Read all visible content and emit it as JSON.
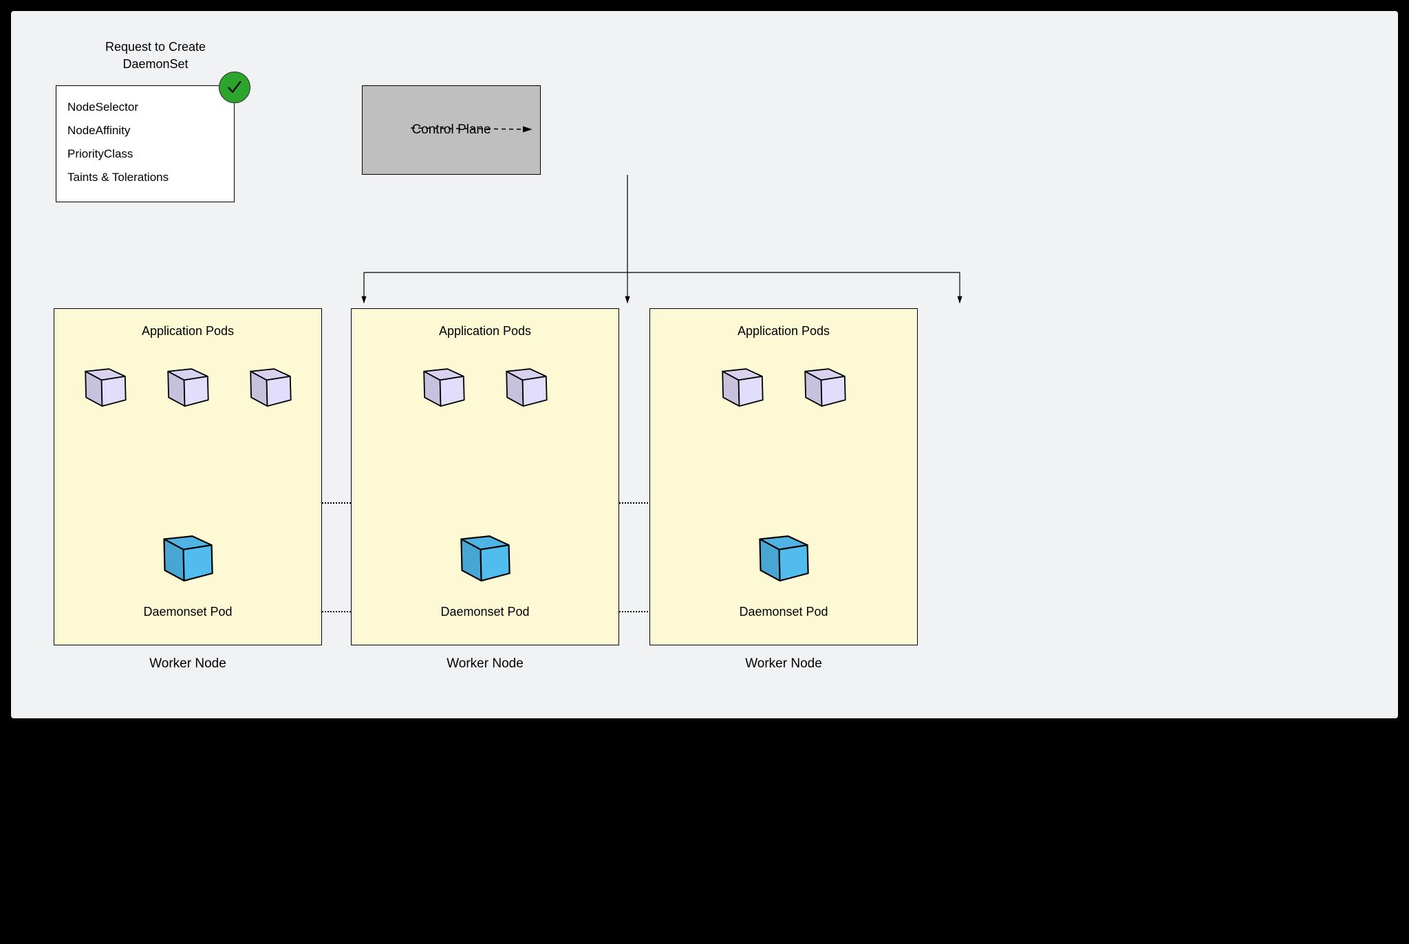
{
  "request": {
    "title_line1": "Request to Create",
    "title_line2": "DaemonSet",
    "items": [
      "NodeSelector",
      "NodeAffinity",
      "PriorityClass",
      "Taints & Tolerations"
    ]
  },
  "control_plane": {
    "label": "Control Plane"
  },
  "workers": [
    {
      "app_label": "Application Pods",
      "app_pod_count": 3,
      "daemon_label": "Daemonset Pod",
      "node_label": "Worker Node"
    },
    {
      "app_label": "Application Pods",
      "app_pod_count": 2,
      "daemon_label": "Daemonset Pod",
      "node_label": "Worker Node"
    },
    {
      "app_label": "Application Pods",
      "app_pod_count": 2,
      "daemon_label": "Daemonset Pod",
      "node_label": "Worker Node"
    }
  ],
  "colors": {
    "app_cube_fill": "#d8d2f0",
    "daemon_cube_fill": "#4fb3e3",
    "check_fill": "#2ba52b"
  }
}
